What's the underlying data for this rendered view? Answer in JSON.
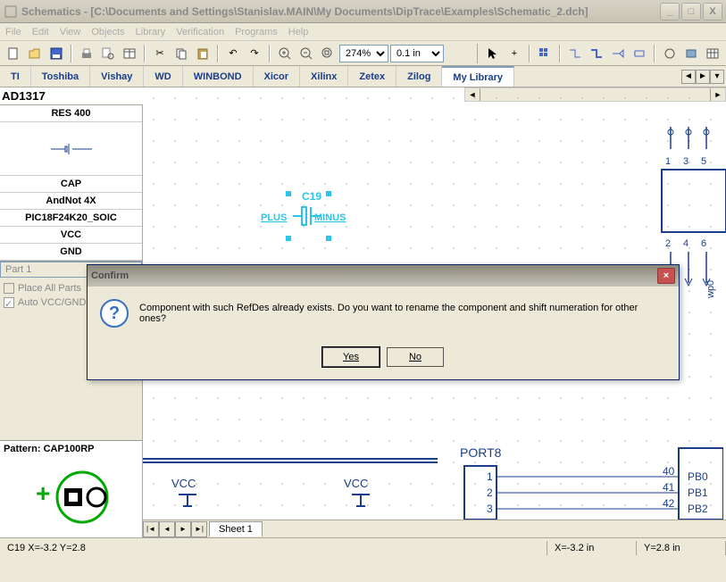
{
  "window": {
    "title": "Schematics - [C:\\Documents and Settings\\Stanislav.MAIN\\My Documents\\DipTrace\\Examples\\Schematic_2.dch]"
  },
  "menu": [
    "File",
    "Edit",
    "View",
    "Objects",
    "Library",
    "Verification",
    "Programs",
    "Help"
  ],
  "toolbar": {
    "zoom": "274%",
    "grid": "0.1 in"
  },
  "library_tabs": [
    "TI",
    "Toshiba",
    "Vishay",
    "WD",
    "WINBOND",
    "Xicor",
    "Xilinx",
    "Zetex",
    "Zilog",
    "My Library"
  ],
  "active_tab": "My Library",
  "filter_value": "AD1317",
  "components": [
    "RES 400",
    "CAP",
    "AndNot 4X",
    "PIC18F24K20_SOIC",
    "VCC",
    "GND"
  ],
  "part_selector": "Part 1",
  "place_all_parts": "Place All Parts",
  "auto_vcc_gnd": "Auto VCC/GND",
  "pattern_label": "Pattern: CAP100RP",
  "sheet_tab": "Sheet 1",
  "status": {
    "left": "C19   X=-3.2   Y=2.8",
    "xpos": "X=-3.2 in",
    "ypos": "Y=2.8 in"
  },
  "modal": {
    "title": "Confirm",
    "message": "Component with such RefDes already exists. Do you want to rename the component and shift numeration for other ones?",
    "yes": "Yes",
    "no": "No"
  },
  "schematic": {
    "c19_ref": "C19",
    "c19_plus": "PLUS",
    "c19_minus": "MINUS",
    "port8": "PORT8",
    "vcc": "VCC",
    "pins_top": [
      "1",
      "3",
      "5"
    ],
    "pins_bot": [
      "2",
      "4",
      "6"
    ],
    "wp": "wp0",
    "pb_labels": [
      "PB0",
      "PB1",
      "PB2"
    ],
    "pb_nums_left": [
      "1",
      "2",
      "3"
    ],
    "pb_nums_right": [
      "40",
      "41",
      "42"
    ]
  }
}
